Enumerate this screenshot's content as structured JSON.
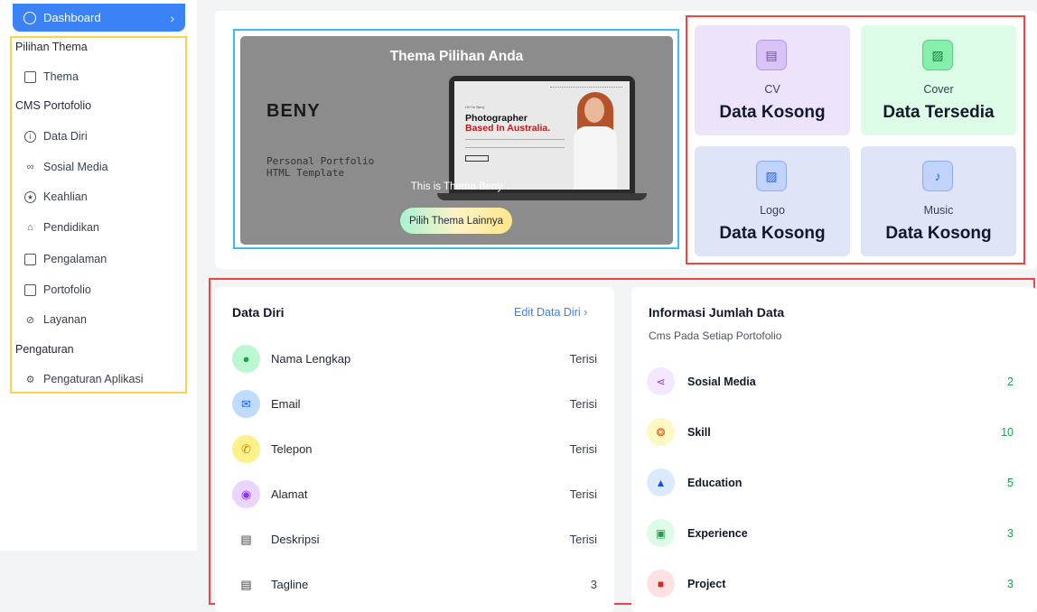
{
  "sidebar": {
    "dashboard_label": "Dashboard",
    "sections": [
      {
        "label": "Pilihan Thema"
      },
      {
        "label": "CMS Portofolio"
      },
      {
        "label": "Pengaturan"
      }
    ],
    "items": [
      {
        "label": "Thema",
        "icon": "palette-icon"
      },
      {
        "label": "Data Diri",
        "icon": "info-icon"
      },
      {
        "label": "Sosial Media",
        "icon": "link-icon"
      },
      {
        "label": "Keahlian",
        "icon": "star-icon"
      },
      {
        "label": "Pendidikan",
        "icon": "graduation-cap-icon"
      },
      {
        "label": "Pengalaman",
        "icon": "briefcase-icon"
      },
      {
        "label": "Portofolio",
        "icon": "folder-icon"
      },
      {
        "label": "Layanan",
        "icon": "service-icon"
      },
      {
        "label": "Pengaturan Aplikasi",
        "icon": "gear-icon"
      }
    ]
  },
  "theme": {
    "title": "Thema Pilihan Anda",
    "brand": "BENY",
    "brand_sub": "Personal Portfolio HTML Template",
    "preview_small": "Hi! I'm Beny",
    "preview_head": "Photographer",
    "preview_head2": "Based In Australia.",
    "caption": "This is Thema Beny",
    "button_label": "Pilih Thema Lainnya"
  },
  "media": [
    {
      "label": "CV",
      "status": "Data Kosong",
      "icon": "document-icon",
      "bg": "#ede4fb",
      "icon_bg": "#d8c4f7",
      "icon_color": "#7c3aed"
    },
    {
      "label": "Cover",
      "status": "Data Tersedia",
      "icon": "image-icon",
      "bg": "#dcfce7",
      "icon_bg": "#86efac",
      "icon_color": "#15803d"
    },
    {
      "label": "Logo",
      "status": "Data Kosong",
      "icon": "image-icon",
      "bg": "#dfe4f7",
      "icon_bg": "#bfd3fb",
      "icon_color": "#2563eb"
    },
    {
      "label": "Music",
      "status": "Data Kosong",
      "icon": "music-icon",
      "bg": "#dfe4f7",
      "icon_bg": "#bfd3fb",
      "icon_color": "#2563eb"
    }
  ],
  "data_diri": {
    "title": "Data Diri",
    "edit_label": "Edit Data Diri  ›",
    "rows": [
      {
        "label": "Nama Lengkap",
        "value": "Terisi",
        "icon": "user-icon",
        "bg": "#bbf7d0",
        "color": "#16a34a"
      },
      {
        "label": "Email",
        "value": "Terisi",
        "icon": "mail-icon",
        "bg": "#bfdbfe",
        "color": "#2563eb"
      },
      {
        "label": "Telepon",
        "value": "Terisi",
        "icon": "phone-icon",
        "bg": "#fef08a",
        "color": "#ca8a04"
      },
      {
        "label": "Alamat",
        "value": "Terisi",
        "icon": "location-pin-icon",
        "bg": "#e9d5ff",
        "color": "#9333ea"
      },
      {
        "label": "Deskripsi",
        "value": "Terisi",
        "icon": "file-icon",
        "bg": "#ffffff",
        "color": "#374151"
      },
      {
        "label": "Tagline",
        "value": "3",
        "icon": "file-icon",
        "bg": "#ffffff",
        "color": "#374151"
      }
    ]
  },
  "info": {
    "title": "Informasi Jumlah Data",
    "subtitle": "Cms Pada Setiap Portofolio",
    "rows": [
      {
        "label": "Sosial Media",
        "count": "2",
        "icon": "share-icon",
        "bg": "#f3e8ff",
        "color": "#9333ea"
      },
      {
        "label": "Skill",
        "count": "10",
        "icon": "brain-icon",
        "bg": "#fef9c3",
        "color": "#ea580c"
      },
      {
        "label": "Education",
        "count": "5",
        "icon": "graduation-cap-icon",
        "bg": "#dbeafe",
        "color": "#1d4ed8"
      },
      {
        "label": "Experience",
        "count": "3",
        "icon": "briefcase-icon",
        "bg": "#dcfce7",
        "color": "#16a34a"
      },
      {
        "label": "Project",
        "count": "3",
        "icon": "folder-icon",
        "bg": "#fee2e2",
        "color": "#dc2626"
      }
    ]
  }
}
